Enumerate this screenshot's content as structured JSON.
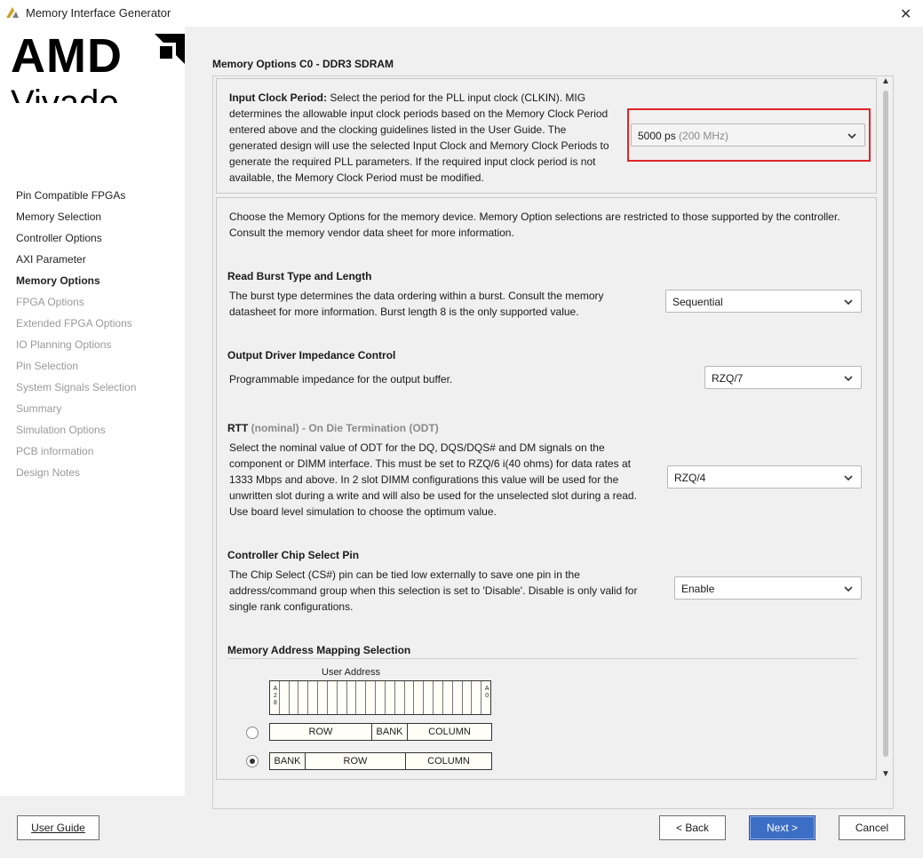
{
  "window": {
    "title": "Memory Interface Generator",
    "close_glyph": "✕"
  },
  "logo": {
    "brand": "AMD",
    "product": "Vivado"
  },
  "steps": [
    {
      "label": "Pin Compatible FPGAs",
      "state": "done"
    },
    {
      "label": "Memory Selection",
      "state": "done"
    },
    {
      "label": "Controller Options",
      "state": "done"
    },
    {
      "label": "AXI Parameter",
      "state": "done"
    },
    {
      "label": "Memory Options",
      "state": "active"
    },
    {
      "label": "FPGA Options",
      "state": "disabled"
    },
    {
      "label": "Extended FPGA Options",
      "state": "disabled"
    },
    {
      "label": "IO Planning Options",
      "state": "disabled"
    },
    {
      "label": "Pin Selection",
      "state": "disabled"
    },
    {
      "label": "System Signals Selection",
      "state": "disabled"
    },
    {
      "label": "Summary",
      "state": "disabled"
    },
    {
      "label": "Simulation Options",
      "state": "disabled"
    },
    {
      "label": "PCB information",
      "state": "disabled"
    },
    {
      "label": "Design Notes",
      "state": "disabled"
    }
  ],
  "page": {
    "heading": "Memory Options C0 - DDR3 SDRAM"
  },
  "input_clock": {
    "title": "Input Clock Period:",
    "lines": [
      " Select the period for the PLL input clock (CLKIN). MIG",
      "determines the allowable input clock periods based on the Memory Clock Period",
      "entered above and the clocking guidelines listed in the User Guide. The",
      "generated design will use the selected Input Clock and Memory Clock Periods to",
      "generate the required PLL parameters. If the required input clock period is not",
      "available, the Memory Clock Period must be modified."
    ],
    "value": "5000 ps",
    "value_sub": "(200 MHz)"
  },
  "options_intro": {
    "lines": [
      "Choose the Memory Options for the memory device. Memory Option selections are restricted to those supported by the controller.",
      "Consult the memory vendor data sheet for more information."
    ]
  },
  "burst": {
    "title": "Read Burst Type and Length",
    "lines": [
      "The burst type determines the data ordering within a burst. Consult the memory",
      "datasheet for more information. Burst length 8 is the only supported value."
    ],
    "value": "Sequential"
  },
  "odi": {
    "title": "Output Driver Impedance Control",
    "lines": [
      "Programmable impedance for the output buffer."
    ],
    "value": "RZQ/7"
  },
  "rtt": {
    "title_main": "RTT",
    "title_muted": " (nominal) - On Die Termination (ODT)",
    "lines": [
      "Select the nominal value of ODT for the DQ, DQS/DQS# and DM signals on the",
      "component or DIMM interface. This must be set to RZQ/6 i(40 ohms) for data rates at",
      "1333 Mbps and above. In 2 slot DIMM configurations this value will be used for the",
      "unwritten slot during a write and will also be used for the unselected slot during a read.",
      "Use board level simulation to choose the optimum value."
    ],
    "value": "RZQ/4"
  },
  "cs": {
    "title": "Controller Chip Select Pin",
    "lines": [
      "The Chip Select (CS#) pin can be tied low externally to save one pin in the",
      "address/command group when this selection is set to 'Disable'. Disable is only valid for",
      "single rank configurations."
    ],
    "value": "Enable"
  },
  "mapping": {
    "title": "Memory Address Mapping Selection",
    "user_address_label": "User Address",
    "msb_label": "A 2 8",
    "lsb_label": "A 0",
    "option1": {
      "row": "ROW",
      "bank": "BANK",
      "column": "COLUMN",
      "selected": false
    },
    "option2": {
      "bank": "BANK",
      "row": "ROW",
      "column": "COLUMN",
      "selected": true
    }
  },
  "buttons": {
    "user_guide": "User Guide",
    "back": "< Back",
    "next": "Next >",
    "cancel": "Cancel"
  },
  "colors": {
    "accent": "#3d6ec6",
    "highlight": "#e0242a",
    "disabled_text": "#9a9a9a"
  }
}
